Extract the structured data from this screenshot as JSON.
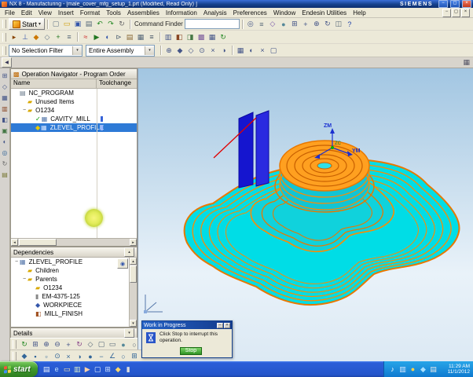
{
  "window": {
    "title": "NX 8 - Manufacturing - [male_cover_mfg_setup_1.prt (Modified, Read Only) ]",
    "brand": "SIEMENS",
    "controls": {
      "minimize": "−",
      "maximize": "◻",
      "close": "×"
    }
  },
  "doc_controls": {
    "minimize": "−",
    "restore": "◻",
    "close": "×"
  },
  "menu": {
    "items": [
      "File",
      "Edit",
      "View",
      "Insert",
      "Format",
      "Tools",
      "Assemblies",
      "Information",
      "Analysis",
      "Preferences",
      "Window",
      "Endesin Utilities",
      "Help"
    ]
  },
  "toolbar": {
    "start_label": "Start",
    "start_arrow": "▾",
    "command_finder_label": "Command Finder",
    "row1": [
      {
        "name": "new",
        "glyph": "▢",
        "color": "#667788"
      },
      {
        "name": "open",
        "glyph": "▭",
        "color": "#cc9900"
      },
      {
        "name": "save",
        "glyph": "▣",
        "color": "#3355aa"
      },
      {
        "name": "print",
        "glyph": "▤",
        "color": "#556677"
      },
      {
        "name": "undo",
        "glyph": "↶",
        "color": "#228822"
      },
      {
        "name": "redo",
        "glyph": "↷",
        "color": "#228822"
      },
      {
        "name": "repeat-command",
        "glyph": "↻",
        "color": "#666666"
      }
    ],
    "row1b": [
      {
        "name": "selection-filter",
        "glyph": "◎",
        "color": "#445588"
      },
      {
        "name": "work-layer",
        "glyph": "≡",
        "color": "#556677"
      },
      {
        "name": "orient-view",
        "glyph": "◇",
        "color": "#7755aa"
      },
      {
        "name": "shaded-view",
        "glyph": "●",
        "color": "#558899"
      },
      {
        "name": "fit-view",
        "glyph": "⊞",
        "color": "#445588"
      },
      {
        "name": "pan-view",
        "glyph": "+",
        "color": "#445588"
      },
      {
        "name": "zoom-view",
        "glyph": "⊕",
        "color": "#445588"
      },
      {
        "name": "rotate-view",
        "glyph": "↻",
        "color": "#445588"
      },
      {
        "name": "window-cascade",
        "glyph": "◫",
        "color": "#556677"
      },
      {
        "name": "help",
        "glyph": "?",
        "color": "#2244aa"
      }
    ],
    "row2a": [
      {
        "name": "create-program",
        "glyph": "▸",
        "color": "#884400"
      },
      {
        "name": "create-tool",
        "glyph": "⊥",
        "color": "#3355aa"
      },
      {
        "name": "create-geometry",
        "glyph": "◆",
        "color": "#cc7700"
      },
      {
        "name": "create-method",
        "glyph": "◇",
        "color": "#667788"
      },
      {
        "name": "create-operation",
        "glyph": "+",
        "color": "#227722"
      },
      {
        "name": "edit-object",
        "glyph": "≡",
        "color": "#556677"
      }
    ],
    "row2b": [
      {
        "name": "generate-toolpath",
        "glyph": "≈",
        "color": "#cc2222"
      },
      {
        "name": "replay-toolpath",
        "glyph": "▶",
        "color": "#227722"
      },
      {
        "name": "verify-toolpath",
        "glyph": "◐",
        "color": "#3355aa"
      },
      {
        "name": "post-process",
        "glyph": "⊳",
        "color": "#556677"
      },
      {
        "name": "shop-documentation",
        "glyph": "▤",
        "color": "#886633"
      },
      {
        "name": "output-cl",
        "glyph": "▦",
        "color": "#556677"
      },
      {
        "name": "list-toolpath",
        "glyph": "≡",
        "color": "#445566"
      }
    ],
    "row2c": [
      {
        "name": "program-order-view",
        "glyph": "▥",
        "color": "#445588"
      },
      {
        "name": "machine-tool-view",
        "glyph": "◧",
        "color": "#884422"
      },
      {
        "name": "geometry-view",
        "glyph": "◨",
        "color": "#447744"
      },
      {
        "name": "machining-method-view",
        "glyph": "▩",
        "color": "#775599"
      },
      {
        "name": "operation-navigator-toggle",
        "glyph": "▦",
        "color": "#445588"
      },
      {
        "name": "synchronize",
        "glyph": "↻",
        "color": "#228822"
      }
    ]
  },
  "selection": {
    "filter": "No Selection Filter",
    "scope": "Entire Assembly",
    "arrow": "▾",
    "icons": [
      {
        "name": "snap-point",
        "glyph": "⊕",
        "color": "#445588"
      },
      {
        "name": "end-point",
        "glyph": "◆",
        "color": "#445588"
      },
      {
        "name": "mid-point",
        "glyph": "◇",
        "color": "#445588"
      },
      {
        "name": "center-point",
        "glyph": "⊙",
        "color": "#445588"
      },
      {
        "name": "intersection-point",
        "glyph": "×",
        "color": "#445588"
      },
      {
        "name": "quadrant-point",
        "glyph": "◑",
        "color": "#445588"
      }
    ],
    "icons2": [
      {
        "name": "select-all",
        "glyph": "▦",
        "color": "#445588"
      },
      {
        "name": "highlight-selection",
        "glyph": "◐",
        "color": "#445588"
      },
      {
        "name": "deselect-all",
        "glyph": "×",
        "color": "#445588"
      },
      {
        "name": "face-rule",
        "glyph": "▢",
        "color": "#445588"
      }
    ]
  },
  "substrip": {
    "collapse_arrow": "◀",
    "right_icon": "▦"
  },
  "resource_bar": {
    "icons": [
      {
        "name": "assembly-navigator",
        "glyph": "⊞",
        "color": "#445588"
      },
      {
        "name": "constraint-navigator",
        "glyph": "◇",
        "color": "#445588"
      },
      {
        "name": "part-navigator",
        "glyph": "▦",
        "color": "#445588"
      },
      {
        "name": "operation-navigator",
        "glyph": "▥",
        "color": "#884422"
      },
      {
        "name": "machine-tool-navigator",
        "glyph": "◧",
        "color": "#445588"
      },
      {
        "name": "reuse-library",
        "glyph": "▣",
        "color": "#447744"
      },
      {
        "name": "hd3d-tools",
        "glyph": "◐",
        "color": "#445588"
      },
      {
        "name": "internet-explorer",
        "glyph": "◎",
        "color": "#336699"
      },
      {
        "name": "history-palette",
        "glyph": "↻",
        "color": "#666666"
      },
      {
        "name": "roles",
        "glyph": "▤",
        "color": "#777733"
      }
    ]
  },
  "navigator": {
    "title": "Operation Navigator - Program Order",
    "columns": [
      "Name",
      "Toolchange"
    ],
    "tree": [
      {
        "label": "NC_PROGRAM",
        "level": 0,
        "icon": {
          "glyph": "▤",
          "color": "#667788"
        }
      },
      {
        "label": "Unused Items",
        "level": 1,
        "icon": {
          "glyph": "▰",
          "color": "#d8a800"
        }
      },
      {
        "label": "O1234",
        "level": 1,
        "exp": "−",
        "icon": {
          "glyph": "▰",
          "color": "#d8a800"
        }
      },
      {
        "label": "CAVITY_MILL",
        "level": 2,
        "status": {
          "glyph": "✓",
          "color": "#009900"
        },
        "icon": {
          "glyph": "▦",
          "color": "#5577aa"
        },
        "toolchange": true
      },
      {
        "label": "ZLEVEL_PROFILE",
        "level": 2,
        "selected": true,
        "status": {
          "glyph": "◆",
          "color": "#e8c800"
        },
        "icon": {
          "glyph": "▦",
          "color": "#cfe2ff"
        },
        "toolchange": true
      }
    ],
    "scroll": {
      "left": "◂",
      "right": "▸"
    }
  },
  "dependencies": {
    "title": "Dependencies",
    "collapse": "▴",
    "tool_icon": "◉",
    "tree": [
      {
        "label": "ZLEVEL_PROFILE",
        "level": 0,
        "exp": "−",
        "icon": {
          "glyph": "▦",
          "color": "#5577aa"
        }
      },
      {
        "label": "Children",
        "level": 1,
        "icon": {
          "glyph": "▰",
          "color": "#d8a800"
        }
      },
      {
        "label": "Parents",
        "level": 1,
        "exp": "−",
        "icon": {
          "glyph": "▰",
          "color": "#d8a800"
        }
      },
      {
        "label": "O1234",
        "level": 2,
        "icon": {
          "glyph": "▰",
          "color": "#d8a800"
        }
      },
      {
        "label": "EM-4375-125",
        "level": 2,
        "icon": {
          "glyph": "▮",
          "color": "#888888"
        }
      },
      {
        "label": "WORKPIECE",
        "level": 2,
        "icon": {
          "glyph": "◆",
          "color": "#3355aa"
        }
      },
      {
        "label": "MILL_FINISH",
        "level": 2,
        "icon": {
          "glyph": "◧",
          "color": "#a05020"
        }
      }
    ],
    "scroll": {
      "up": "▴",
      "down": "▾"
    }
  },
  "details": {
    "title": "Details",
    "collapse": "▾"
  },
  "docks": {
    "rowA": [
      {
        "name": "refresh-view",
        "glyph": "↻",
        "color": "#228822"
      },
      {
        "name": "fit-view",
        "glyph": "⊞",
        "color": "#445588"
      },
      {
        "name": "zoom-in",
        "glyph": "⊕",
        "color": "#445588"
      },
      {
        "name": "zoom-out",
        "glyph": "⊖",
        "color": "#445588"
      },
      {
        "name": "pan",
        "glyph": "+",
        "color": "#445588"
      },
      {
        "name": "rotate",
        "glyph": "↻",
        "color": "#884488"
      },
      {
        "name": "trimetric-view",
        "glyph": "◇",
        "color": "#556677"
      },
      {
        "name": "front-view",
        "glyph": "▢",
        "color": "#556677"
      },
      {
        "name": "top-view",
        "glyph": "▭",
        "color": "#556677"
      },
      {
        "name": "shaded",
        "glyph": "●",
        "color": "#558899"
      },
      {
        "name": "wireframe",
        "glyph": "○",
        "color": "#556677"
      }
    ],
    "rowB": [
      {
        "name": "snap-enable",
        "glyph": "◆",
        "color": "#336699"
      },
      {
        "name": "snap-endpoint",
        "glyph": "▪",
        "color": "#336699"
      },
      {
        "name": "snap-midpoint",
        "glyph": "▫",
        "color": "#336699"
      },
      {
        "name": "snap-center",
        "glyph": "⊙",
        "color": "#336699"
      },
      {
        "name": "snap-intersection",
        "glyph": "×",
        "color": "#336699"
      },
      {
        "name": "snap-quadrant",
        "glyph": "◑",
        "color": "#336699"
      },
      {
        "name": "snap-existing-point",
        "glyph": "●",
        "color": "#336699"
      },
      {
        "name": "snap-midline",
        "glyph": "−",
        "color": "#336699"
      },
      {
        "name": "snap-angle",
        "glyph": "∠",
        "color": "#336699"
      },
      {
        "name": "snap-tangent",
        "glyph": "○",
        "color": "#336699"
      },
      {
        "name": "snap-grid",
        "glyph": "⊞",
        "color": "#336699"
      },
      {
        "name": "curve-rule",
        "glyph": "≈",
        "color": "#336699"
      }
    ]
  },
  "viewport": {
    "axes": {
      "zm": "ZM",
      "zc": "ZC",
      "ym": "YM"
    }
  },
  "dialog": {
    "title": "Work in Progress",
    "minimize": "−",
    "close": "×",
    "message": "Click Stop to interrupt this operation.",
    "stop_label": "Stop"
  },
  "taskbar": {
    "start_label": "start",
    "time": "11:29 AM",
    "date": "11/1/2012",
    "quick_launch": [
      {
        "name": "show-desktop",
        "glyph": "▤",
        "color": "#eaf2ff"
      },
      {
        "name": "internet-explorer",
        "glyph": "e",
        "color": "#bfe0ff"
      },
      {
        "name": "email",
        "glyph": "▭",
        "color": "#ffe9a8"
      },
      {
        "name": "file-explorer",
        "glyph": "▥",
        "color": "#d8ecc8"
      },
      {
        "name": "media-player",
        "glyph": "▶",
        "color": "#ffd2a8"
      },
      {
        "name": "notepad",
        "glyph": "▢",
        "color": "#e8f4ff"
      },
      {
        "name": "calculator",
        "glyph": "⊞",
        "color": "#cfe2ff"
      },
      {
        "name": "nx-shortcut",
        "glyph": "◆",
        "color": "#ffd86a"
      },
      {
        "name": "command-prompt",
        "glyph": "▮",
        "color": "#dddddd"
      }
    ],
    "tray": [
      {
        "name": "volume",
        "glyph": "♪",
        "color": "#ffffff"
      },
      {
        "name": "network",
        "glyph": "▥",
        "color": "#d8e8ff"
      },
      {
        "name": "antivirus",
        "glyph": "●",
        "color": "#ffd24a"
      },
      {
        "name": "updates",
        "glyph": "◆",
        "color": "#a8e0ff"
      },
      {
        "name": "usb-device",
        "glyph": "▤",
        "color": "#e8e8e8"
      }
    ]
  },
  "colors": {
    "titlebar": "#16418c",
    "selection_highlight": "#2e7ad6",
    "viewport_gradient_top": "#a2c6e2",
    "viewport_gradient_bottom": "#e9f2f9",
    "model_surface_cyan": "#00dde6",
    "toolpath_orange": "#ff8a00",
    "tool_display_blue": "#1515cf",
    "rapid_move_red": "#e00000",
    "taskbar_blue": "#2456cb",
    "start_button_green": "#3f9a2e",
    "click_highlight_yellow": "#e6ef62"
  }
}
